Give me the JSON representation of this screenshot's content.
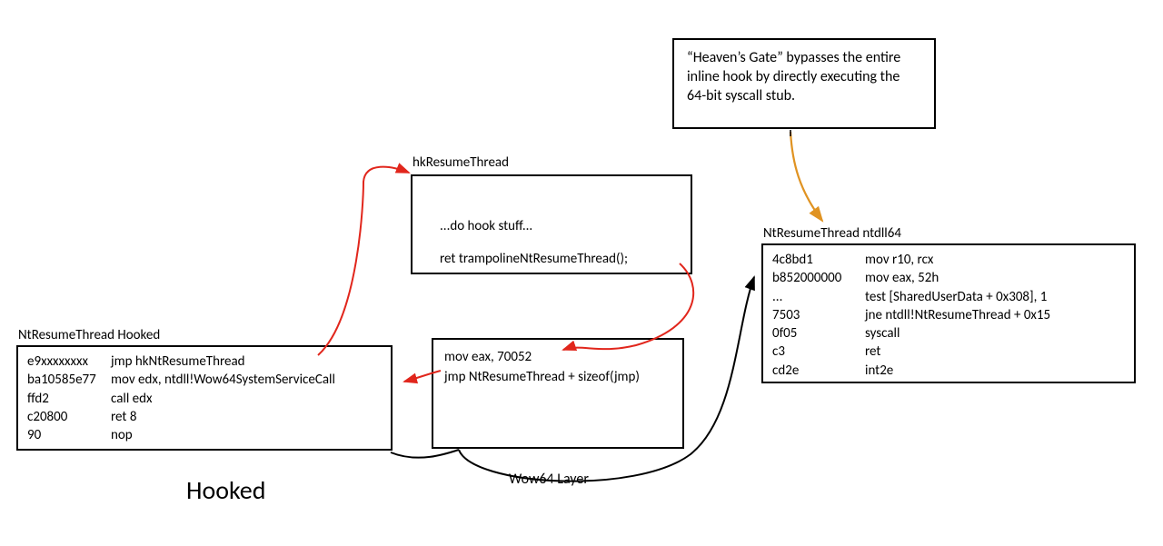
{
  "callout": {
    "text": "“Heaven’s Gate” bypasses the entire inline hook by directly executing the 64-bit syscall stub."
  },
  "hooked": {
    "title": "NtResumeThread  Hooked",
    "lines": [
      {
        "hex": "e9xxxxxxxx",
        "asm": "jmp hkNtResumeThread"
      },
      {
        "hex": "ba10585e77",
        "asm": "mov edx, ntdll!Wow64SystemServiceCall"
      },
      {
        "hex": "ffd2",
        "asm": "call edx"
      },
      {
        "hex": "c20800",
        "asm": "ret 8"
      },
      {
        "hex": "90",
        "asm": "nop"
      }
    ]
  },
  "hook": {
    "title": "hkResumeThread",
    "body_line1": "...do hook stuff...",
    "body_line2": "ret trampolineNtResumeThread();"
  },
  "trampoline": {
    "line1": "mov eax, 70052",
    "line2": "jmp NtResumeThread + sizeof(jmp)"
  },
  "ntdll64": {
    "title": "NtResumeThread ntdll64",
    "lines": [
      {
        "hex": "4c8bd1",
        "asm": "mov r10, rcx"
      },
      {
        "hex": "b852000000",
        "asm": "mov eax, 52h"
      },
      {
        "hex": "...",
        "asm": "test [SharedUserData + 0x308], 1"
      },
      {
        "hex": "7503",
        "asm": "jne ntdll!NtResumeThread + 0x15"
      },
      {
        "hex": "0f05",
        "asm": "syscall"
      },
      {
        "hex": "c3",
        "asm": "ret"
      },
      {
        "hex": "cd2e",
        "asm": "int2e"
      }
    ]
  },
  "labels": {
    "hooked_big": "Hooked",
    "wow64": "Wow64 Layer"
  }
}
